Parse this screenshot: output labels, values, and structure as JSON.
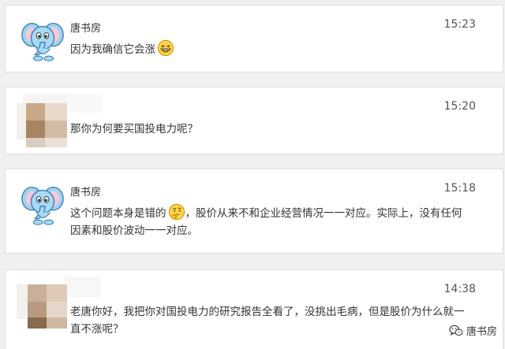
{
  "messages": [
    {
      "sender": "唐书房",
      "time": "15:23",
      "text": "因为我确信它会涨",
      "emoji": "grin-icon",
      "avatar": "elephant-avatar"
    },
    {
      "sender": "",
      "time": "15:20",
      "text": "那你为何要买国投电力呢？",
      "avatar": "blurred-avatar"
    },
    {
      "sender": "唐书房",
      "time": "15:18",
      "text_before_emoji": "这个问题本身是错的",
      "emoji": "thinking-icon",
      "text_after_emoji": "，股价从来不和企业经营情况一一对应。实际上，没有任何因素和股价波动一一对应。",
      "avatar": "elephant-avatar"
    },
    {
      "sender": "",
      "time": "14:38",
      "text": "老唐你好，我把你对国投电力的研究报告全看了，没挑出毛病，但是股价为什么就一直不涨呢？",
      "avatar": "blurred-avatar"
    }
  ],
  "watermark": {
    "icon": "wechat-icon",
    "label": "唐书房"
  },
  "colors": {
    "background": "#f0f0f0",
    "card": "#ffffff",
    "border": "#dedede",
    "text": "#333333"
  }
}
